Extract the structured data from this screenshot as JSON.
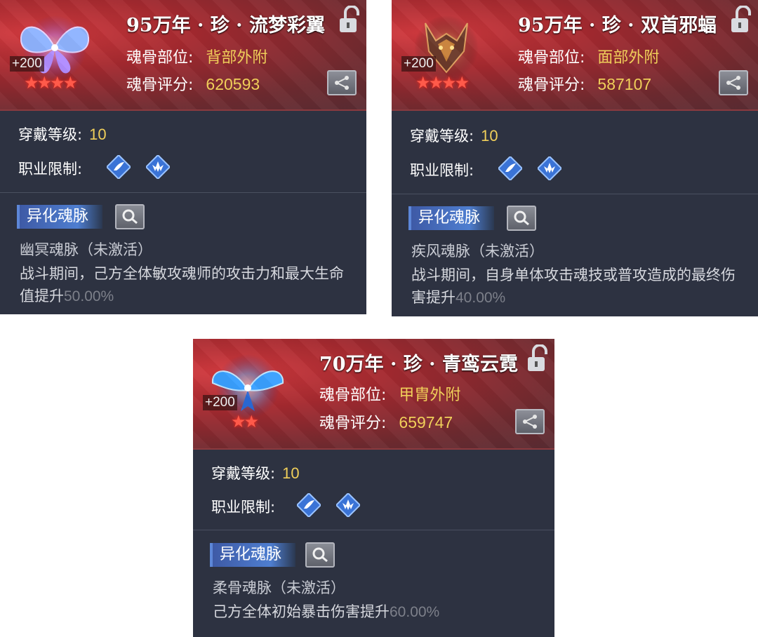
{
  "cards": [
    {
      "title": "95万年 · 珍 · 流梦彩翼",
      "level_badge": "+200",
      "stars": "★★★★",
      "part_label": "魂骨部位:",
      "part_value": "背部外附",
      "score_label": "魂骨评分:",
      "score_value": "620593",
      "wear_level_label": "穿戴等级:",
      "wear_level_value": "10",
      "profession_label": "职业限制:",
      "vein_tag": "异化魂脉",
      "vein_name": "幽冥魂脉（未激活）",
      "desc_text": "战斗期间，己方全体敏攻魂师的攻击力和最大生命值提升",
      "desc_pct": "50.00%"
    },
    {
      "title": "95万年 · 珍 · 双首邪蝠",
      "level_badge": "+200",
      "stars": "★★★★",
      "part_label": "魂骨部位:",
      "part_value": "面部外附",
      "score_label": "魂骨评分:",
      "score_value": "587107",
      "wear_level_label": "穿戴等级:",
      "wear_level_value": "10",
      "profession_label": "职业限制:",
      "vein_tag": "异化魂脉",
      "vein_name": "疾风魂脉（未激活）",
      "desc_text": "战斗期间，自身单体攻击魂技或普攻造成的最终伤害提升",
      "desc_pct": "40.00%"
    },
    {
      "title": "70万年 · 珍 · 青鸾云霓",
      "level_badge": "+200",
      "stars": "★★",
      "part_label": "魂骨部位:",
      "part_value": "甲胄外附",
      "score_label": "魂骨评分:",
      "score_value": "659747",
      "wear_level_label": "穿戴等级:",
      "wear_level_value": "10",
      "profession_label": "职业限制:",
      "vein_tag": "异化魂脉",
      "vein_name": "柔骨魂脉（未激活）",
      "desc_text": "己方全体初始暴击伤害提升",
      "desc_pct": "60.00%"
    }
  ],
  "icons": {
    "lock": "lock-open-icon",
    "share": "share-icon",
    "search": "magnifier-icon",
    "profession_1": "wing-icon",
    "profession_2": "lotus-icon"
  },
  "colors": {
    "header_red": "#a4292f",
    "body_bg": "#2d3241",
    "value_gold": "#f0cf5a",
    "tag_blue": "#4e7ed0",
    "star_red": "#ff5a4a"
  }
}
